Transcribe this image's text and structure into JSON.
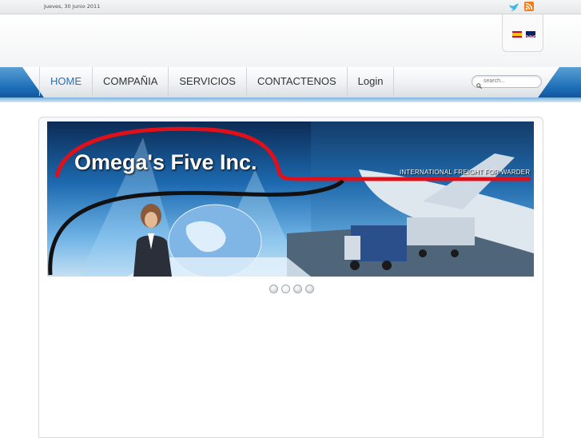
{
  "topbar": {
    "date": "Jueves, 30 Junio 2011",
    "icons": [
      "twitter-icon",
      "rss-icon"
    ]
  },
  "languages": [
    {
      "name": "Español",
      "icon": "flag-spain-icon"
    },
    {
      "name": "English",
      "icon": "flag-uk-icon"
    }
  ],
  "nav": {
    "items": [
      {
        "label": "HOME",
        "active": true
      },
      {
        "label": "COMPAÑIA",
        "active": false
      },
      {
        "label": "SERVICIOS",
        "active": false
      },
      {
        "label": "CONTACTENOS",
        "active": false
      },
      {
        "label": "Login",
        "active": false
      }
    ]
  },
  "search": {
    "placeholder": "search...",
    "value": ""
  },
  "banner": {
    "title": "Omega's Five Inc.",
    "subtitle": "INTERNATIONAL FREIGHT FOR WARDER"
  },
  "slider": {
    "slide_count": 4,
    "active_index": 1
  },
  "colors": {
    "accent": "#2a6fb5",
    "nav_band": "#1d6fb8",
    "banner_red": "#e0101a",
    "rss": "#f27d1a"
  }
}
